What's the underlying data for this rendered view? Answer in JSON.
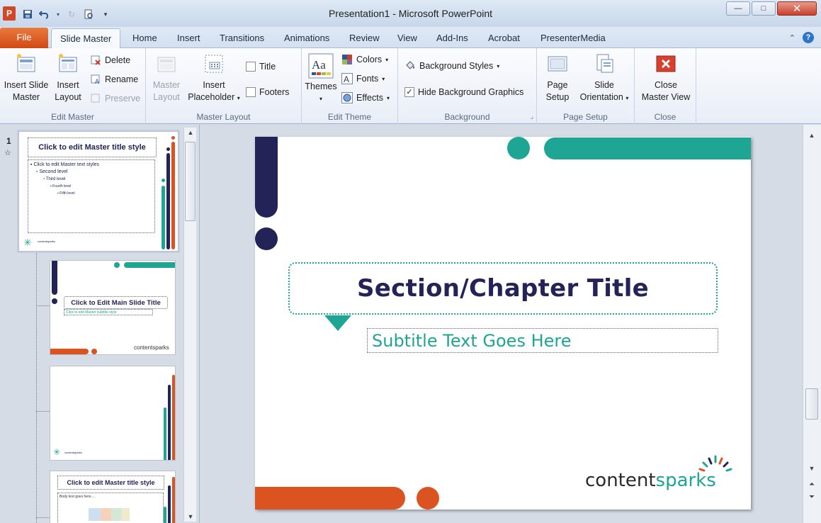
{
  "window": {
    "title": "Presentation1 - Microsoft PowerPoint",
    "app_icon_letter": "P",
    "minimize": "—",
    "maximize": "□",
    "close": "✕"
  },
  "tabs": {
    "file": "File",
    "items": [
      "Slide Master",
      "Home",
      "Insert",
      "Transitions",
      "Animations",
      "Review",
      "View",
      "Add-Ins",
      "Acrobat",
      "PresenterMedia"
    ],
    "help": "?"
  },
  "ribbon": {
    "edit_master": {
      "label": "Edit Master",
      "insert_slide_master": [
        "Insert Slide",
        "Master"
      ],
      "insert_layout": [
        "Insert",
        "Layout"
      ],
      "delete": "Delete",
      "rename": "Rename",
      "preserve": "Preserve"
    },
    "master_layout": {
      "label": "Master Layout",
      "master_layout_btn": [
        "Master",
        "Layout"
      ],
      "insert_placeholder": [
        "Insert",
        "Placeholder"
      ],
      "title": "Title",
      "footers": "Footers"
    },
    "edit_theme": {
      "label": "Edit Theme",
      "themes": "Themes",
      "colors": "Colors",
      "fonts": "Fonts",
      "effects": "Effects"
    },
    "background": {
      "label": "Background",
      "background_styles": "Background Styles",
      "hide_bg_graphics": "Hide Background Graphics"
    },
    "page_setup": {
      "label": "Page Setup",
      "page_setup_btn": [
        "Page",
        "Setup"
      ],
      "slide_orientation": [
        "Slide",
        "Orientation"
      ]
    },
    "close": {
      "label": "Close",
      "close_master_view": [
        "Close",
        "Master View"
      ]
    }
  },
  "thumbnails": {
    "master_number": "1",
    "master_title": "Click to edit Master title style",
    "master_levels": [
      "Click to edit Master text styles",
      "Second level",
      "Third level",
      "Fourth level",
      "Fifth level"
    ],
    "layout2_title": "Click to Edit Main Slide Title",
    "layout2_subtitle": "Click to edit Master subtitle style",
    "layout4_title": "Click to edit Master title style",
    "layout4_body": "Body text goes here....",
    "brand_small": "contentsparks"
  },
  "slide": {
    "title": "Section/Chapter Title",
    "subtitle": "Subtitle Text Goes Here",
    "brand_a": "content",
    "brand_b": "sparks"
  },
  "colors": {
    "navy": "#232358",
    "teal": "#1ea593",
    "orange": "#dc5322"
  }
}
